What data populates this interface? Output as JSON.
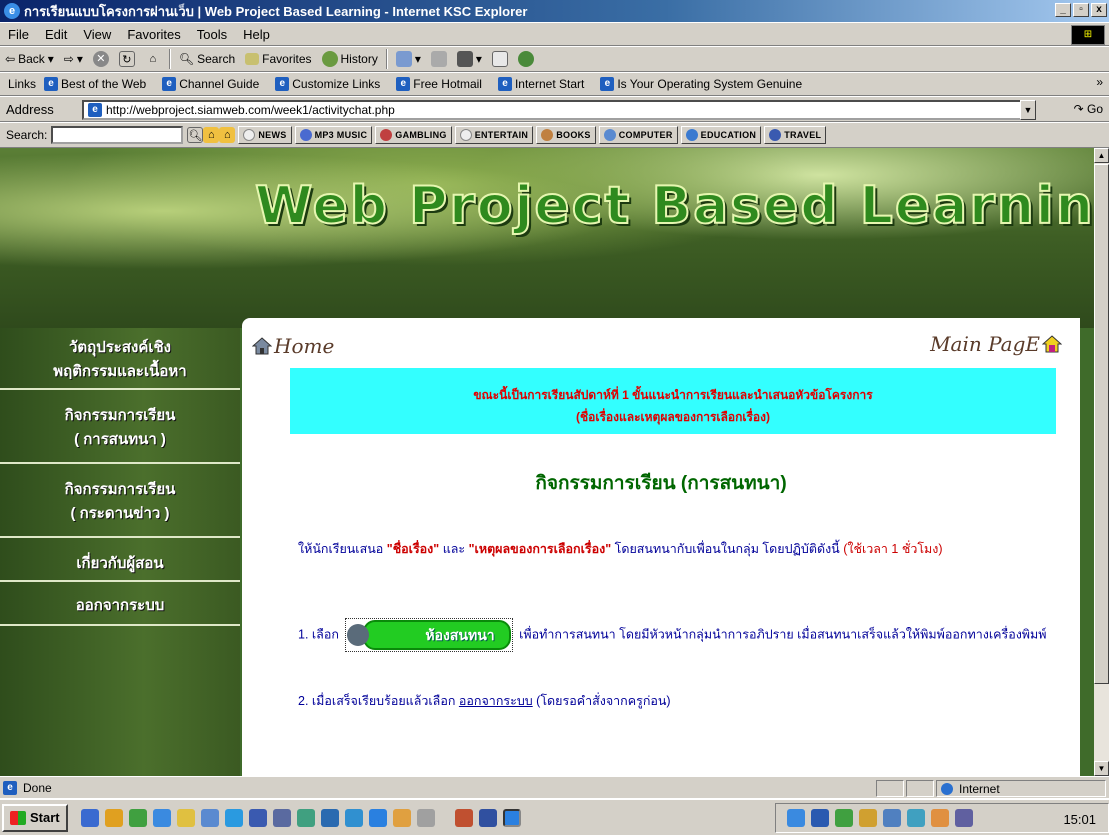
{
  "window": {
    "title": "การเรียนแบบโครงการผ่านเว็บ | Web Project Based Learning - Internet KSC Explorer",
    "controls": [
      "_",
      "▫",
      "x"
    ]
  },
  "menu": [
    "File",
    "Edit",
    "View",
    "Favorites",
    "Tools",
    "Help"
  ],
  "toolbar": {
    "back": "Back",
    "search": "Search",
    "favorites": "Favorites",
    "history": "History"
  },
  "links": {
    "label": "Links",
    "items": [
      "Best of the Web",
      "Channel Guide",
      "Customize Links",
      "Free Hotmail",
      "Internet Start",
      "Is Your Operating System Genuine"
    ],
    "overflow": "»"
  },
  "address": {
    "label": "Address",
    "url": "http://webproject.siamweb.com/week1/activitychat.php",
    "go": "Go"
  },
  "searchbar": {
    "label": "Search:",
    "buttons": [
      "NEWS",
      "MP3 MUSIC",
      "GAMBLING",
      "ENTERTAIN",
      "BOOKS",
      "COMPUTER",
      "EDUCATION",
      "TRAVEL"
    ]
  },
  "page": {
    "banner_title": "Web Project Based Learning",
    "sidebar": [
      "วัตถุประสงค์เชิง",
      "พฤติกรรมและเนื้อหา",
      "กิจกรรมการเรียน",
      "( การสนทนา )",
      "กิจกรรมการเรียน",
      "( กระดานข่าว )",
      "เกี่ยวกับผู้สอน",
      "ออกจากระบบ"
    ],
    "home_link": "Home",
    "main_link": "Main PagE",
    "notice_line1": "ขณะนี้เป็นการเรียนสัปดาห์ที่ 1 ขั้นแนะนำการเรียนและนำเสนอหัวข้อโครงการ",
    "notice_line2": "(ชื่อเรื่องและเหตุผลของการเลือกเรื่อง)",
    "activity_title": "กิจกรรมการเรียน (การสนทนา)",
    "instr": {
      "p1": "ให้นักเรียนเสนอ",
      "k1": "\"ชื่อเรื่อง\"",
      "p2": "และ",
      "k2": "\"เหตุผลของการเลือกเรื่อง\"",
      "p3": "โดยสนทนากับเพื่อนในกลุ่ม โดยปฏิบัติดังนี้",
      "time": "(ใช้เวลา 1 ชั่วโมง)"
    },
    "step1": {
      "prefix": "1. เลือก",
      "button": "ห้องสนทนา",
      "suffix": "เพื่อทำการสนทนา โดยมีหัวหน้ากลุ่มนำการอภิปราย เมื่อสนทนาเสร็จแล้วให้พิมพ์ออกทางเครื่องพิมพ์"
    },
    "step2": {
      "prefix": "2. เมื่อเสร็จเรียบร้อยแล้วเลือก",
      "link": "ออกจากระบบ",
      "suffix": "(โดยรอคำสั่งจากครูก่อน)"
    }
  },
  "status": {
    "text": "Done",
    "zone": "Internet"
  },
  "taskbar": {
    "start": "Start",
    "clock": "15:01"
  }
}
